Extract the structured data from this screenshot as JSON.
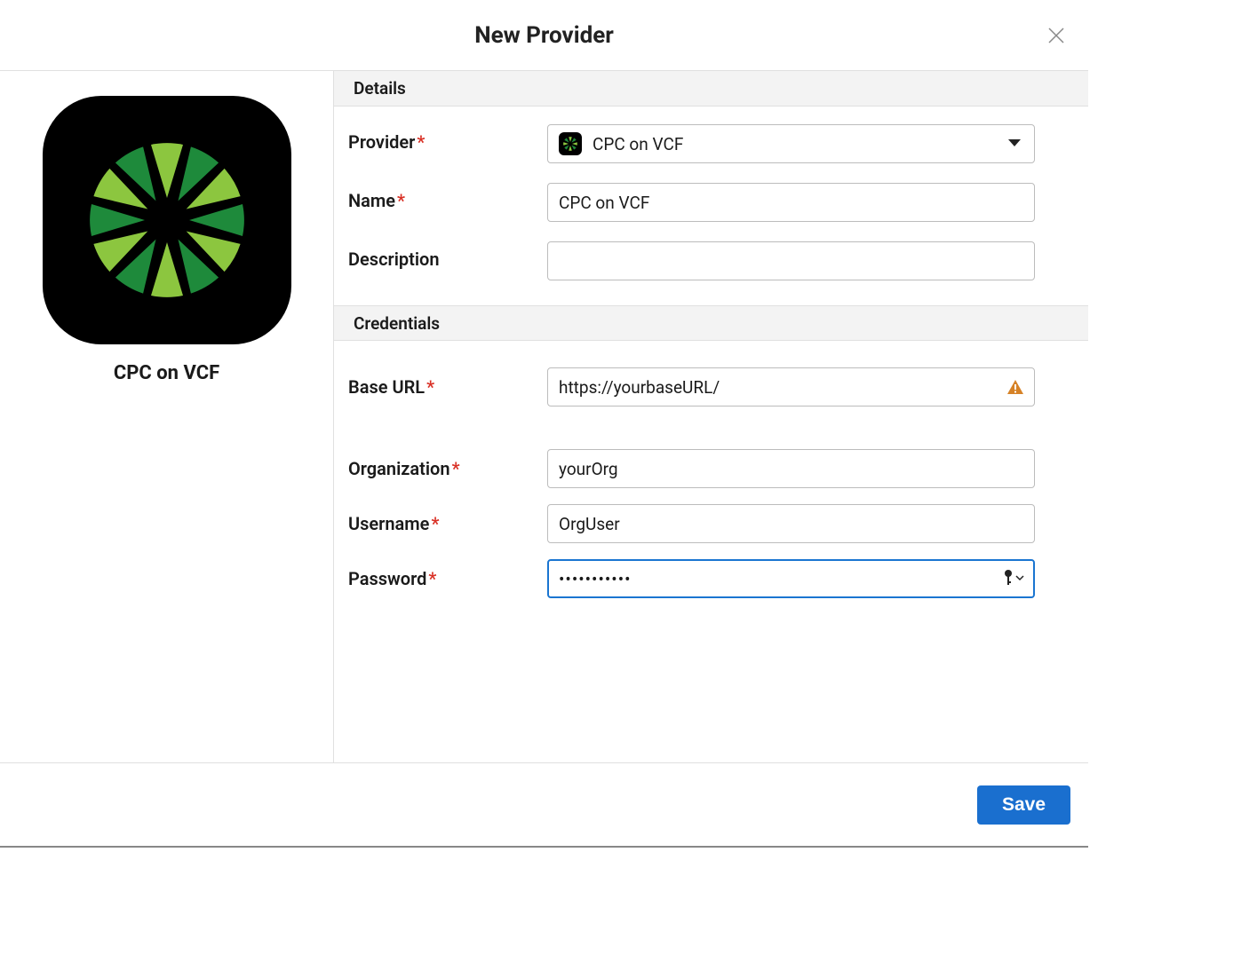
{
  "header": {
    "title": "New Provider"
  },
  "sidebar": {
    "logo_caption": "CPC on VCF"
  },
  "sections": {
    "details": "Details",
    "credentials": "Credentials"
  },
  "labels": {
    "provider": "Provider",
    "name": "Name",
    "description": "Description",
    "base_url": "Base URL",
    "organization": "Organization",
    "username": "Username",
    "password": "Password"
  },
  "fields": {
    "provider_selected": "CPC on VCF",
    "name": "CPC on VCF",
    "description": "",
    "base_url": "https://yourbaseURL/",
    "organization": "yourOrg",
    "username": "OrgUser",
    "password": "•••••••••••"
  },
  "footer": {
    "save": "Save"
  }
}
